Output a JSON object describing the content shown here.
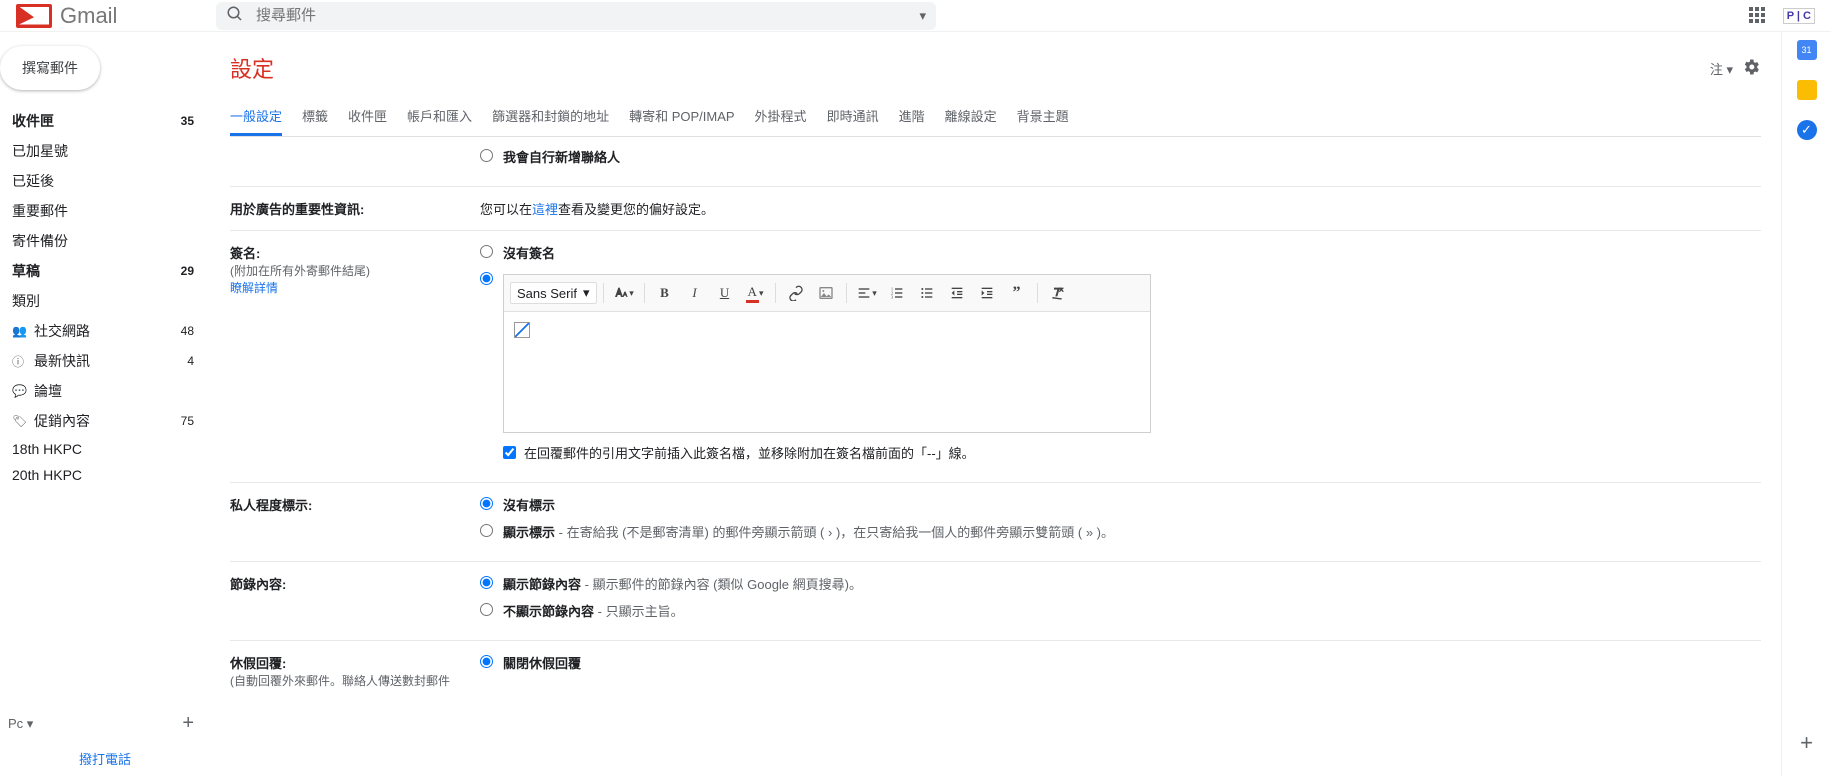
{
  "header": {
    "logo_text": "Gmail",
    "search_placeholder": "搜尋郵件",
    "pc_badge": "P | C"
  },
  "compose_label": "撰寫郵件",
  "nav_items": [
    {
      "label": "收件匣",
      "count": "35",
      "bold": true
    },
    {
      "label": "已加星號",
      "count": ""
    },
    {
      "label": "已延後",
      "count": ""
    },
    {
      "label": "重要郵件",
      "count": ""
    },
    {
      "label": "寄件備份",
      "count": ""
    },
    {
      "label": "草稿",
      "count": "29",
      "bold": true
    },
    {
      "label": "類別",
      "count": ""
    }
  ],
  "nav_categories": [
    {
      "label": "社交網路",
      "count": "48"
    },
    {
      "label": "最新快訊",
      "count": "4"
    },
    {
      "label": "論壇",
      "count": ""
    },
    {
      "label": "促銷內容",
      "count": "75"
    },
    {
      "label": "18th HKPC",
      "count": ""
    },
    {
      "label": "20th HKPC",
      "count": ""
    }
  ],
  "account_label": "Pc",
  "call_label": "撥打電話",
  "settings": {
    "title": "設定",
    "density_label": "注",
    "tabs": [
      "一般設定",
      "標籤",
      "收件匣",
      "帳戶和匯入",
      "篩選器和封鎖的地址",
      "轉寄和 POP/IMAP",
      "外掛程式",
      "即時通訊",
      "進階",
      "離線設定",
      "背景主題"
    ],
    "contact_option": "我會自行新增聯絡人",
    "ads_label": "用於廣告的重要性資訊:",
    "ads_text_pre": "您可以在",
    "ads_link": "這裡",
    "ads_text_post": "查看及變更您的偏好設定。",
    "sig_label": "簽名:",
    "sig_sub": "(附加在所有外寄郵件結尾)",
    "sig_learn": "瞭解詳情",
    "sig_none": "沒有簽名",
    "font_family": "Sans Serif",
    "sig_checkbox": "在回覆郵件的引用文字前插入此簽名檔，並移除附加在簽名檔前面的「--」線。",
    "indicator_label": "私人程度標示:",
    "indicator_none": "沒有標示",
    "indicator_show_bold": "顯示標示",
    "indicator_show_rest": " - 在寄給我 (不是郵寄清單) 的郵件旁顯示箭頭 ( › )，在只寄給我一個人的郵件旁顯示雙箭頭 ( » )。",
    "snippet_label": "節錄內容:",
    "snippet_show_bold": "顯示節錄內容",
    "snippet_show_rest": " - 顯示郵件的節錄內容 (類似 Google 網頁搜尋)。",
    "snippet_hide_bold": "不顯示節錄內容",
    "snippet_hide_rest": " - 只顯示主旨。",
    "vacation_label": "休假回覆:",
    "vacation_sub": "(自動回覆外來郵件。聯絡人傳送數封郵件",
    "vacation_off": "關閉休假回覆"
  },
  "rail": {
    "cal": "31",
    "task": "✓"
  }
}
